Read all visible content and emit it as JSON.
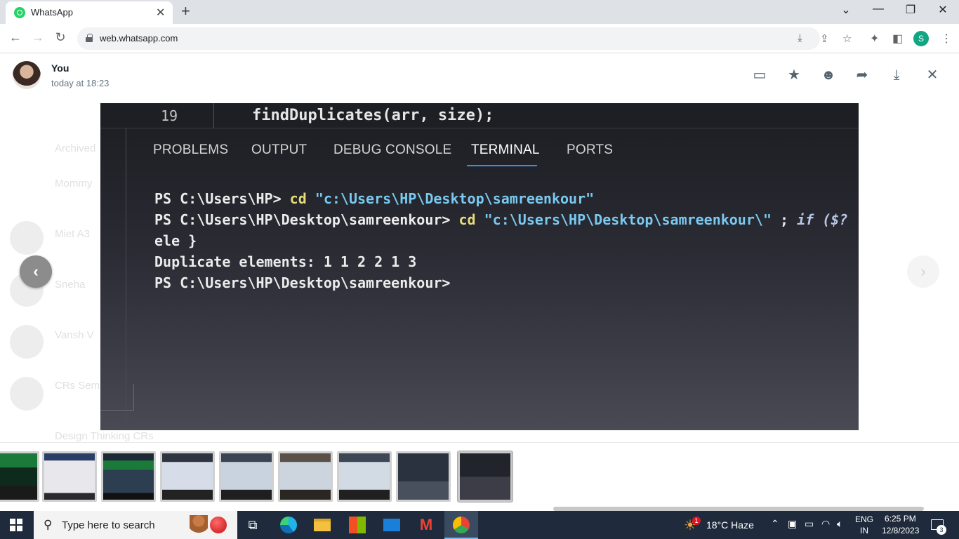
{
  "browser": {
    "tab_title": "WhatsApp",
    "url": "web.whatsapp.com",
    "profile_initial": "S"
  },
  "viewer": {
    "sender": "You",
    "timestamp": "today at 18:23"
  },
  "photo": {
    "line_number": "19",
    "code_line": "findDuplicates(arr, size);",
    "panel_tabs": [
      "PROBLEMS",
      "OUTPUT",
      "DEBUG CONSOLE",
      "TERMINAL",
      "PORTS"
    ],
    "active_tab": "TERMINAL",
    "terminal": {
      "l1_prompt": "PS C:\\Users\\HP> ",
      "l1_cmd": "cd",
      "l1_arg": " \"c:\\Users\\HP\\Desktop\\samreenkour\"",
      "l2_prompt": "PS C:\\Users\\HP\\Desktop\\samreenkour> ",
      "l2_cmd": "cd",
      "l2_arg": " \"c:\\Users\\HP\\Desktop\\samreenkour\\\"",
      "l2_sep": " ; ",
      "l2_kw": "if ($?",
      "l3": "ele }",
      "l4": "Duplicate elements: 1 1 2 2 1 3",
      "l5": "PS C:\\Users\\HP\\Desktop\\samreenkour>"
    }
  },
  "background_chats": [
    "Archived",
    "Mommy",
    "Miet A3",
    "Sneha",
    "Vansh V",
    "CRs Sem",
    "Design Thinking CRs"
  ],
  "taskbar": {
    "search_placeholder": "Type here to search",
    "weather": "18°C  Haze",
    "weather_badge": "1",
    "lang_top": "ENG",
    "lang_bottom": "IN",
    "time": "6:25 PM",
    "date": "12/8/2023",
    "notification_count": "3"
  }
}
